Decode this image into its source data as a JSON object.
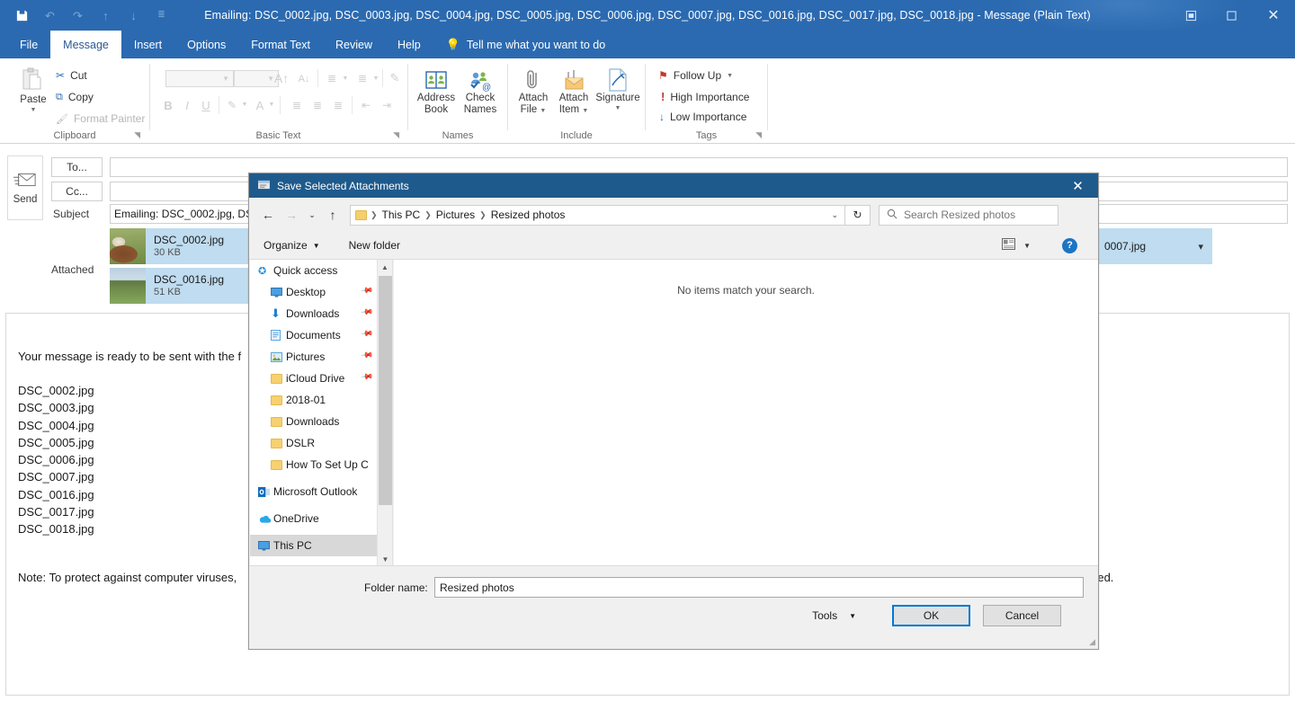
{
  "window": {
    "title": "Emailing: DSC_0002.jpg, DSC_0003.jpg, DSC_0004.jpg, DSC_0005.jpg, DSC_0006.jpg, DSC_0007.jpg, DSC_0016.jpg, DSC_0017.jpg, DSC_0018.jpg  -  Message (Plain Text)",
    "accent": "#2b6ab0",
    "qat": [
      {
        "name": "save-icon",
        "glyph": "💾"
      },
      {
        "name": "undo-icon",
        "glyph": "↶"
      },
      {
        "name": "redo-icon",
        "glyph": "↷"
      },
      {
        "name": "previous-item-icon",
        "glyph": "↑"
      },
      {
        "name": "next-item-icon",
        "glyph": "↓"
      },
      {
        "name": "customize-quick-access-toolbar-icon",
        "glyph": "⩟"
      }
    ],
    "controls": [
      {
        "name": "restore-down-button",
        "glyph": "⧉"
      },
      {
        "name": "maximize-button",
        "glyph": "□"
      },
      {
        "name": "close-button",
        "glyph": "✕"
      }
    ]
  },
  "ribbon": {
    "tabs": [
      "File",
      "Message",
      "Insert",
      "Options",
      "Format Text",
      "Review",
      "Help"
    ],
    "active_tab": "Message",
    "tell_me": "Tell me what you want to do",
    "collapse_glyph": "⌃",
    "groups": [
      {
        "label": "Clipboard",
        "paste": "Paste",
        "items": [
          {
            "label": "Cut",
            "icon": "scissors-icon",
            "glyph": "✂",
            "disabled": false
          },
          {
            "label": "Copy",
            "icon": "copy-icon",
            "glyph": "⧉",
            "disabled": false
          },
          {
            "label": "Format Painter",
            "icon": "format-painter-icon",
            "glyph": "🖌",
            "disabled": true
          }
        ]
      },
      {
        "label": "Basic Text",
        "buttons": [
          "B",
          "I",
          "U",
          "A"
        ],
        "grow_font": "A",
        "shrink_font": "A"
      },
      {
        "label": "Names",
        "items": [
          {
            "label": "Address Book",
            "line1": "Address",
            "line2": "Book",
            "icon": "address-book-icon"
          },
          {
            "label": "Check Names",
            "line1": "Check",
            "line2": "Names",
            "icon": "check-names-icon"
          }
        ]
      },
      {
        "label": "Include",
        "items": [
          {
            "label": "Attach File",
            "line1": "Attach",
            "line2": "File",
            "icon": "paperclip-icon",
            "caret": true
          },
          {
            "label": "Attach Item",
            "line1": "Attach",
            "line2": "Item",
            "icon": "attach-item-icon",
            "caret": true
          },
          {
            "label": "Signature",
            "line1": "Signature",
            "line2": "",
            "icon": "signature-icon",
            "caret": true
          }
        ]
      },
      {
        "label": "Tags",
        "items": [
          {
            "label": "Follow Up",
            "icon": "flag-icon",
            "glyph": "⚑",
            "color": "#c0392b",
            "caret": true
          },
          {
            "label": "High Importance",
            "icon": "exclamation-icon",
            "glyph": "!",
            "color": "#c0392b",
            "caret": false
          },
          {
            "label": "Low Importance",
            "icon": "down-arrow-icon",
            "glyph": "↓",
            "color": "#2b6ab0",
            "caret": false
          }
        ]
      }
    ]
  },
  "compose": {
    "send_label": "Send",
    "to_label": "To...",
    "cc_label": "Cc...",
    "subject_label": "Subject",
    "attached_label": "Attached",
    "to_value": "",
    "cc_value": "",
    "subject_value": "Emailing: DSC_0002.jpg, DSC_",
    "attachments": [
      {
        "name": "DSC_0002.jpg",
        "size": "30 KB",
        "thumb": "horse"
      },
      {
        "name": "DSC_0016.jpg",
        "size": "51 KB",
        "thumb": "field"
      },
      {
        "name": "0007.jpg",
        "size": "",
        "thumb": "none",
        "has_chevron": true
      }
    ],
    "body_intro": "Your message is ready to be sent with the f",
    "body_files": "DSC_0002.jpg\nDSC_0003.jpg\nDSC_0004.jpg\nDSC_0005.jpg\nDSC_0006.jpg\nDSC_0007.jpg\nDSC_0016.jpg\nDSC_0017.jpg\nDSC_0018.jpg",
    "body_note_left": "Note: To protect against computer viruses,",
    "body_note_right": "ndled."
  },
  "dialog": {
    "title": "Save Selected Attachments",
    "close_glyph": "✕",
    "nav": {
      "back_glyph": "←",
      "forward_glyph": "→",
      "recent_glyph": "⌄",
      "up_glyph": "↑",
      "breadcrumbs": [
        "This PC",
        "Pictures",
        "Resized photos"
      ],
      "dropdown_glyph": "⌄",
      "refresh_glyph": "↻",
      "search_placeholder": "Search Resized photos",
      "search_icon": "search-icon"
    },
    "commands": {
      "organize": "Organize",
      "new_folder": "New folder",
      "view_icon": "change-view-icon",
      "view_caret": "▼",
      "help": "?"
    },
    "sidebar": [
      {
        "label": "Quick access",
        "icon": "star-icon",
        "indent": 0,
        "pinned": false,
        "selected": false
      },
      {
        "label": "Desktop",
        "icon": "desktop-icon",
        "indent": 1,
        "pinned": true,
        "selected": false
      },
      {
        "label": "Downloads",
        "icon": "downloads-icon",
        "indent": 1,
        "pinned": true,
        "selected": false
      },
      {
        "label": "Documents",
        "icon": "documents-icon",
        "indent": 1,
        "pinned": true,
        "selected": false
      },
      {
        "label": "Pictures",
        "icon": "pictures-icon",
        "indent": 1,
        "pinned": true,
        "selected": false
      },
      {
        "label": "iCloud Drive",
        "icon": "folder-icon",
        "indent": 1,
        "pinned": true,
        "selected": false
      },
      {
        "label": "2018-01",
        "icon": "folder-icon",
        "indent": 1,
        "pinned": false,
        "selected": false
      },
      {
        "label": "Downloads",
        "icon": "folder-icon",
        "indent": 1,
        "pinned": false,
        "selected": false
      },
      {
        "label": "DSLR",
        "icon": "folder-icon",
        "indent": 1,
        "pinned": false,
        "selected": false
      },
      {
        "label": "How To Set Up C",
        "icon": "folder-icon",
        "indent": 1,
        "pinned": false,
        "selected": false
      },
      {
        "label": "Microsoft Outlook",
        "icon": "outlook-icon",
        "indent": 0,
        "pinned": false,
        "selected": false
      },
      {
        "label": "OneDrive",
        "icon": "onedrive-icon",
        "indent": 0,
        "pinned": false,
        "selected": false
      },
      {
        "label": "This PC",
        "icon": "this-pc-icon",
        "indent": 0,
        "pinned": false,
        "selected": true
      }
    ],
    "file_list_empty": "No items match your search.",
    "footer": {
      "folder_name_label": "Folder name:",
      "folder_name_value": "Resized photos",
      "tools_label": "Tools",
      "tools_caret": "▼",
      "ok_label": "OK",
      "cancel_label": "Cancel"
    }
  }
}
